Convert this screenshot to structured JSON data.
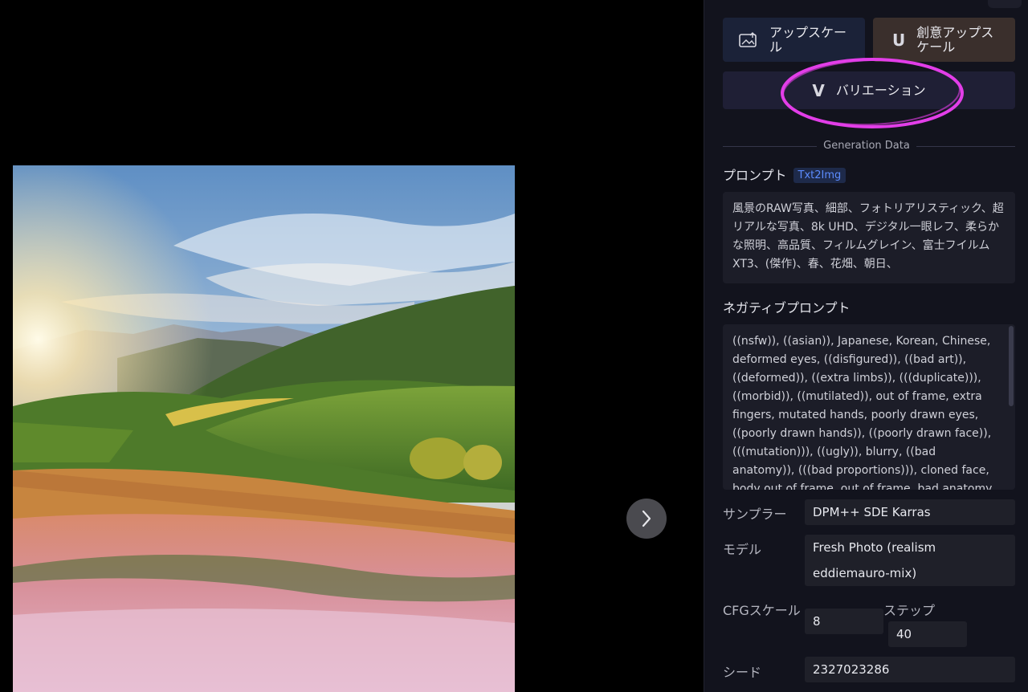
{
  "viewer": {
    "next_icon": "chevron-right-icon"
  },
  "actions": {
    "upscale_label": "アップスケール",
    "upscale_icon": "image-upscale-icon",
    "creative_upscale_label": "創意アップスケール",
    "creative_upscale_icon": "U",
    "variation_label": "バリエーション",
    "variation_icon": "V",
    "highlight_color": "#e23ee8"
  },
  "generation": {
    "section_label": "Generation Data",
    "prompt_title": "プロンプト",
    "prompt_tag": "Txt2Img",
    "prompt_text": "風景のRAW写真、細部、フォトリアリスティック、超リアルな写真、8k UHD、デジタル一眼レフ、柔らかな照明、高品質、フィルムグレイン、富士フイルムXT3、(傑作)、春、花畑、朝日、",
    "negative_title": "ネガティブプロンプト",
    "negative_text": "((nsfw)), ((asian)), Japanese, Korean, Chinese, deformed eyes, ((disfigured)), ((bad art)), ((deformed)), ((extra limbs)), (((duplicate))), ((morbid)), ((mutilated)), out of frame, extra fingers, mutated hands, poorly drawn eyes, ((poorly drawn hands)), ((poorly drawn face)), (((mutation))), ((ugly)), blurry, ((bad anatomy)), (((bad proportions))), cloned face, body out of frame, out of frame, bad anatomy, gross proportions",
    "sampler_label": "サンプラー",
    "sampler_value": "DPM++ SDE Karras",
    "model_label": "モデル",
    "model_value": "Fresh Photo (realism eddiemauro-mix)",
    "cfg_label": "CFGスケール",
    "cfg_value": "8",
    "steps_label": "ステップ",
    "steps_value": "40",
    "seed_label": "シード",
    "seed_value": "2327023286"
  }
}
